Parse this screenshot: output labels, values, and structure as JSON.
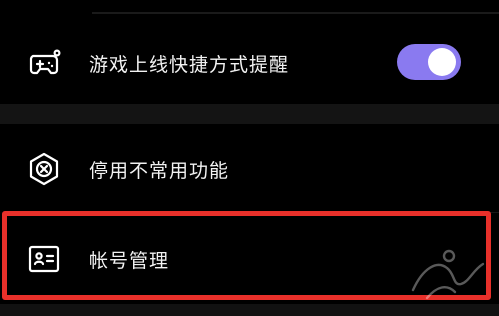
{
  "settings": {
    "items": [
      {
        "label": "游戏上线快捷方式提醒",
        "icon": "gamepad-icon",
        "toggle_on": true
      },
      {
        "label": "停用不常用功能",
        "icon": "hexagon-x-icon"
      },
      {
        "label": "帐号管理",
        "icon": "id-card-icon"
      }
    ]
  },
  "colors": {
    "toggle_on": "#8a7af0",
    "highlight": "#e8302a",
    "text": "#f2f2f2",
    "background": "#000000"
  }
}
